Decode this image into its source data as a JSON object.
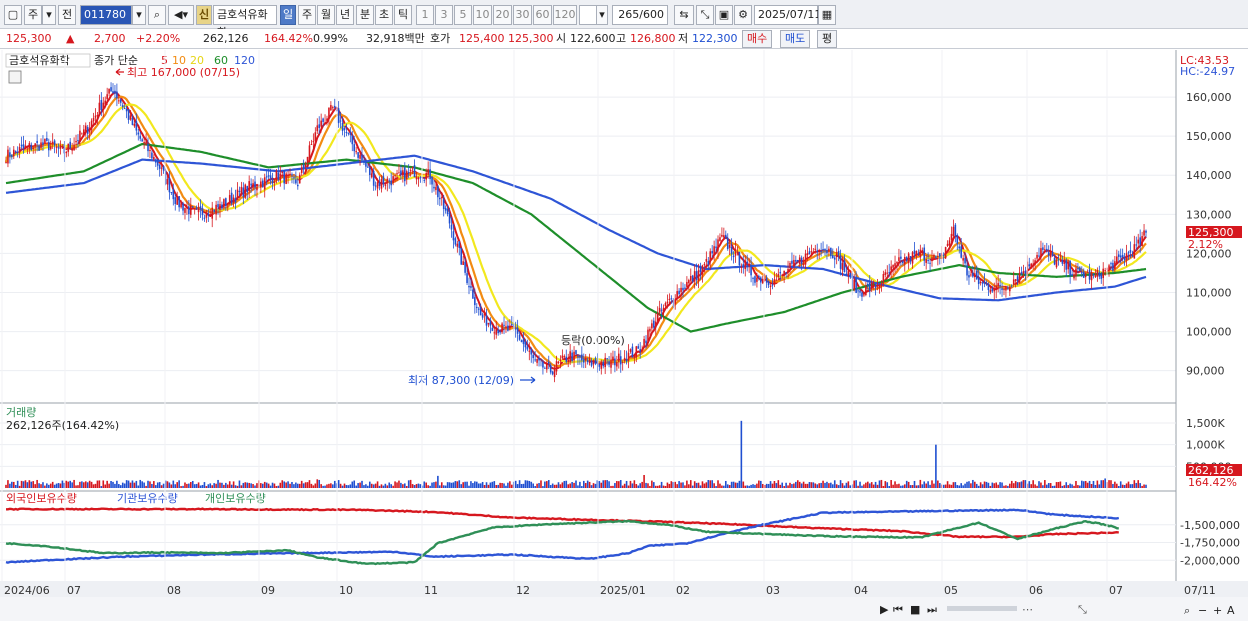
{
  "toolbar": {
    "mode_label": "주",
    "prev_label": "전",
    "code": "011780",
    "search_icon": "search-icon",
    "sound_icon": "speaker-icon",
    "sin_label": "신",
    "stock_name": "금호석유화학",
    "periods": [
      "일",
      "주",
      "월",
      "년",
      "분",
      "초",
      "틱"
    ],
    "active_period": "일",
    "intervals": [
      "1",
      "3",
      "5",
      "10",
      "20",
      "30",
      "60",
      "120"
    ],
    "count": "265",
    "total": "/600",
    "date": "2025/07/11"
  },
  "info": {
    "price": "125,300",
    "arrow": "▲",
    "change": "2,700",
    "change_pct": "+2.20%",
    "volume": "262,126",
    "vol_ratio": "164.42%",
    "turnover": "0.99%",
    "amount": "32,918백만",
    "hoga_label": "호가",
    "hoga_ask": "125,400",
    "hoga_bid": "125,300",
    "open_label": "시",
    "open": "122,600",
    "high_label": "고",
    "high": "126,800",
    "low_label": "저",
    "low": "122,300",
    "buy_label": "매수",
    "sell_label": "매도",
    "avg_label": "평"
  },
  "colors": {
    "up": "#d6171e",
    "down": "#1f4fd1",
    "ma5": "#d6171e",
    "ma10": "#f28b12",
    "ma20": "#f2e81e",
    "ma60": "#1e8e2a",
    "ma120": "#2e55d6",
    "foreign": "#d6171e",
    "institution": "#2e55d6",
    "individual": "#2f8f57"
  },
  "chart_data": [
    {
      "type": "candlestick",
      "title": "금호석유화학",
      "legend": [
        "종가 단순",
        "5",
        "10",
        "20",
        "60",
        "120"
      ],
      "lc_label": "LC:43.53",
      "hc_label": "HC:-24.97",
      "y_ticks": [
        "160,000",
        "150,000",
        "140,000",
        "130,000",
        "120,000",
        "110,000",
        "100,000",
        "90,000"
      ],
      "y_range": [
        83000,
        170000
      ],
      "x_ticks": [
        "2024/06",
        "07",
        "08",
        "09",
        "10",
        "11",
        "12",
        "2025/01",
        "02",
        "03",
        "04",
        "05",
        "06",
        "07",
        "07/11"
      ],
      "price_label": "125,300",
      "price_pct_label": "2.12%",
      "price_value": 125300,
      "high_annotation": "최고 167,000 (07/15)",
      "low_annotation": "최저 87,300 (12/09)",
      "limit_annotation": "등락(0.00%)",
      "close_keypoints": [
        [
          0,
          145000
        ],
        [
          10,
          147000
        ],
        [
          20,
          148000
        ],
        [
          30,
          146000
        ],
        [
          42,
          152000
        ],
        [
          50,
          159000
        ],
        [
          55,
          162000
        ],
        [
          60,
          158000
        ],
        [
          68,
          150000
        ],
        [
          78,
          143000
        ],
        [
          88,
          133000
        ],
        [
          98,
          130000
        ],
        [
          110,
          132000
        ],
        [
          125,
          137000
        ],
        [
          140,
          140000
        ],
        [
          150,
          138000
        ],
        [
          160,
          152000
        ],
        [
          168,
          157000
        ],
        [
          178,
          148000
        ],
        [
          190,
          138000
        ],
        [
          200,
          139000
        ],
        [
          210,
          141000
        ],
        [
          218,
          140000
        ],
        [
          228,
          128000
        ],
        [
          236,
          115000
        ],
        [
          244,
          104000
        ],
        [
          252,
          101000
        ],
        [
          262,
          100000
        ],
        [
          272,
          92000
        ],
        [
          280,
          90000
        ],
        [
          290,
          94000
        ],
        [
          298,
          92000
        ],
        [
          310,
          92000
        ],
        [
          325,
          95000
        ],
        [
          335,
          104000
        ],
        [
          345,
          110000
        ],
        [
          358,
          116000
        ],
        [
          368,
          124000
        ],
        [
          376,
          119000
        ],
        [
          385,
          114000
        ],
        [
          395,
          113000
        ],
        [
          408,
          118000
        ],
        [
          418,
          122000
        ],
        [
          426,
          120000
        ],
        [
          438,
          110000
        ],
        [
          448,
          112000
        ],
        [
          460,
          118000
        ],
        [
          470,
          120000
        ],
        [
          480,
          118000
        ],
        [
          487,
          126000
        ],
        [
          494,
          115000
        ],
        [
          502,
          112000
        ],
        [
          512,
          111000
        ],
        [
          522,
          115000
        ],
        [
          532,
          121000
        ],
        [
          540,
          118000
        ],
        [
          550,
          115000
        ],
        [
          560,
          114000
        ],
        [
          572,
          118000
        ],
        [
          582,
          122000
        ],
        [
          586,
          125300
        ]
      ],
      "series": [
        {
          "name": "5",
          "key": "ma5",
          "window": 5
        },
        {
          "name": "10",
          "key": "ma10",
          "window": 10
        },
        {
          "name": "20",
          "key": "ma20",
          "window": 20
        },
        {
          "name": "60",
          "key": "ma60",
          "window": 60
        },
        {
          "name": "120",
          "key": "ma120",
          "window": 120
        }
      ],
      "ma120_keypoints": [
        [
          0,
          135500
        ],
        [
          40,
          138000
        ],
        [
          70,
          144000
        ],
        [
          100,
          143000
        ],
        [
          140,
          141000
        ],
        [
          175,
          143000
        ],
        [
          210,
          145000
        ],
        [
          240,
          141000
        ],
        [
          280,
          134000
        ],
        [
          310,
          126000
        ],
        [
          335,
          120000
        ],
        [
          360,
          116000
        ],
        [
          390,
          117000
        ],
        [
          420,
          116000
        ],
        [
          450,
          112000
        ],
        [
          480,
          108500
        ],
        [
          510,
          108000
        ],
        [
          540,
          110000
        ],
        [
          570,
          111500
        ],
        [
          586,
          114000
        ]
      ],
      "ma60_keypoints": [
        [
          0,
          138000
        ],
        [
          40,
          141000
        ],
        [
          70,
          148000
        ],
        [
          100,
          146000
        ],
        [
          135,
          142000
        ],
        [
          175,
          144000
        ],
        [
          210,
          142000
        ],
        [
          240,
          138000
        ],
        [
          270,
          130000
        ],
        [
          300,
          118000
        ],
        [
          330,
          106000
        ],
        [
          352,
          100000
        ],
        [
          370,
          102000
        ],
        [
          400,
          105000
        ],
        [
          430,
          110000
        ],
        [
          460,
          114000
        ],
        [
          490,
          117000
        ],
        [
          510,
          115000
        ],
        [
          540,
          114000
        ],
        [
          570,
          115000
        ],
        [
          586,
          116000
        ]
      ]
    },
    {
      "type": "bar",
      "title": "거래량",
      "volume_label": "262,126주(164.42%)",
      "y_ticks": [
        "1,500K",
        "1,000K",
        "500,000"
      ],
      "y_range": [
        0,
        1800000
      ],
      "last_value_label": "262,126",
      "last_pct_label": "164.42%",
      "spikes": [
        [
          378,
          1550000
        ],
        [
          478,
          1000000
        ],
        [
          328,
          300000
        ],
        [
          222,
          280000
        ],
        [
          565,
          220000
        ],
        [
          160,
          200000
        ]
      ],
      "base_volume": 110000
    },
    {
      "type": "line",
      "legend": [
        "외국인보유수량",
        "기관보유수량",
        "개인보유수량"
      ],
      "y_ticks": [
        "-1,500,000",
        "-1,750,000",
        "-2,000,000"
      ],
      "y_range": [
        -2250000,
        -1250000
      ],
      "series": [
        {
          "name": "외국인보유수량",
          "key": "foreign",
          "keypoints": [
            [
              0,
              -1280000
            ],
            [
              100,
              -1280000
            ],
            [
              180,
              -1290000
            ],
            [
              220,
              -1320000
            ],
            [
              260,
              -1400000
            ],
            [
              300,
              -1430000
            ],
            [
              340,
              -1460000
            ],
            [
              380,
              -1500000
            ],
            [
              410,
              -1540000
            ],
            [
              460,
              -1590000
            ],
            [
              490,
              -1670000
            ],
            [
              520,
              -1670000
            ],
            [
              540,
              -1630000
            ],
            [
              572,
              -1610000
            ]
          ]
        },
        {
          "name": "기관보유수량",
          "key": "institution",
          "keypoints": [
            [
              0,
              -2030000
            ],
            [
              20,
              -2000000
            ],
            [
              60,
              -1950000
            ],
            [
              100,
              -1920000
            ],
            [
              150,
              -1900000
            ],
            [
              200,
              -1880000
            ],
            [
              220,
              -1950000
            ],
            [
              260,
              -1920000
            ],
            [
              300,
              -1980000
            ],
            [
              320,
              -1900000
            ],
            [
              330,
              -1800000
            ],
            [
              350,
              -1760000
            ],
            [
              380,
              -1550000
            ],
            [
              420,
              -1330000
            ],
            [
              470,
              -1310000
            ],
            [
              520,
              -1290000
            ],
            [
              540,
              -1360000
            ],
            [
              560,
              -1390000
            ],
            [
              572,
              -1410000
            ]
          ]
        },
        {
          "name": "개인보유수량",
          "key": "individual",
          "keypoints": [
            [
              0,
              -1760000
            ],
            [
              20,
              -1800000
            ],
            [
              50,
              -1900000
            ],
            [
              80,
              -1890000
            ],
            [
              110,
              -1900000
            ],
            [
              145,
              -1860000
            ],
            [
              160,
              -1960000
            ],
            [
              185,
              -2050000
            ],
            [
              210,
              -2030000
            ],
            [
              222,
              -1760000
            ],
            [
              250,
              -1540000
            ],
            [
              280,
              -1490000
            ],
            [
              320,
              -1450000
            ],
            [
              340,
              -1500000
            ],
            [
              360,
              -1600000
            ],
            [
              380,
              -1620000
            ],
            [
              420,
              -1660000
            ],
            [
              470,
              -1680000
            ],
            [
              500,
              -1470000
            ],
            [
              520,
              -1700000
            ],
            [
              540,
              -1550000
            ],
            [
              555,
              -1450000
            ],
            [
              565,
              -1500000
            ],
            [
              572,
              -1550000
            ]
          ]
        }
      ]
    }
  ]
}
